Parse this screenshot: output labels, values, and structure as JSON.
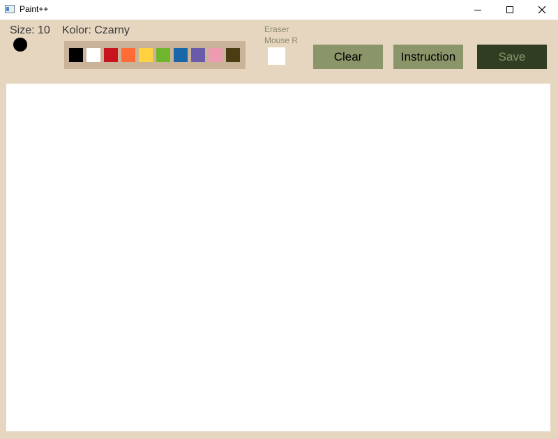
{
  "window": {
    "title": "Paint++"
  },
  "toolbar": {
    "size_label": "Size: 10",
    "color_label": "Kolor: Czarny",
    "palette": [
      "#000000",
      "#ffffff",
      "#c8141e",
      "#ff6b35",
      "#ffd23f",
      "#6fb62e",
      "#1966a8",
      "#6a5aaa",
      "#ee9ab0",
      "#4b3c14"
    ],
    "eraser_line1": "Eraser",
    "eraser_line2": "Mouse R",
    "clear_label": "Clear",
    "instruction_label": "Instruction",
    "save_label": "Save"
  }
}
